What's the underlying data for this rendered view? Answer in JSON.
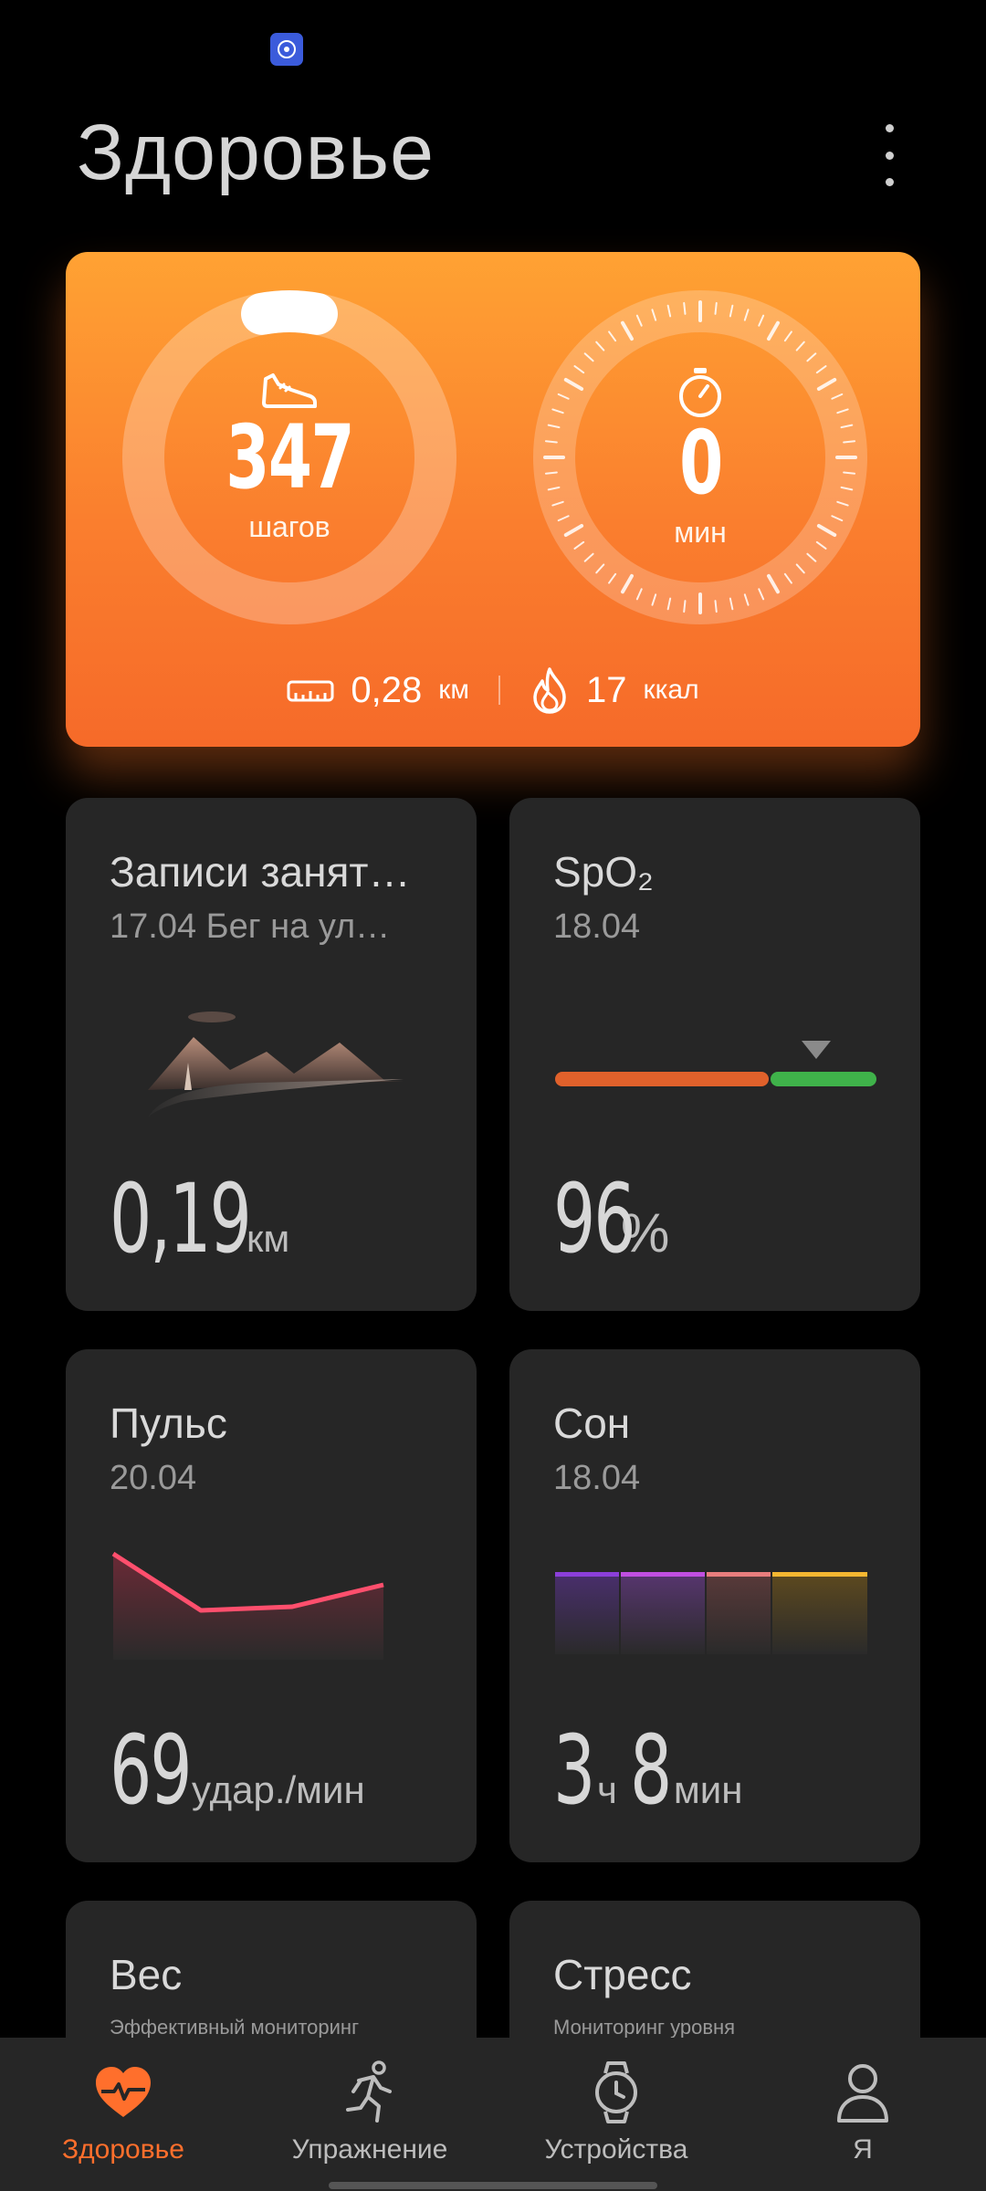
{
  "header": {
    "title": "Здоровье"
  },
  "activity": {
    "steps": "347",
    "steps_unit": "шагов",
    "steps_progress": 0.06,
    "active_minutes": "0",
    "minutes_unit": "мин",
    "distance_value": "0,28",
    "distance_unit": "км",
    "calories_value": "17",
    "calories_unit": "ккал",
    "accent_colors": [
      "#ffa233",
      "#f66a29"
    ]
  },
  "cards": {
    "workouts": {
      "title": "Записи занят…",
      "subtitle": "17.04 Бег на ул…",
      "value": "0,19",
      "unit": "км"
    },
    "spo2": {
      "title": "SpO₂",
      "subtitle": "18.04",
      "value": "96",
      "unit": "%",
      "bar_colors": [
        "#e0612b",
        "#3fb24a"
      ]
    },
    "heart_rate": {
      "title": "Пульс",
      "subtitle": "20.04",
      "value": "69",
      "unit": "удар./мин",
      "line_color": "#ff4f6d"
    },
    "sleep": {
      "title": "Сон",
      "subtitle": "18.04",
      "hours": "3",
      "hours_unit": "ч",
      "minutes": "8",
      "minutes_unit": "мин",
      "stage_colors": [
        "#8b3fd9",
        "#c04fe0",
        "#e87d7d",
        "#f5b731"
      ]
    },
    "weight": {
      "title": "Вес",
      "subtitle": "Эффективный мониторинг"
    },
    "stress": {
      "title": "Стресс",
      "subtitle": "Мониторинг уровня"
    }
  },
  "nav": {
    "items": [
      {
        "label": "Здоровье",
        "icon": "heart-pulse-icon",
        "active": true
      },
      {
        "label": "Упражнение",
        "icon": "running-person-icon"
      },
      {
        "label": "Устройства",
        "icon": "watch-icon"
      },
      {
        "label": "Я",
        "icon": "person-icon"
      }
    ],
    "active_color": "#ff6f2c"
  }
}
